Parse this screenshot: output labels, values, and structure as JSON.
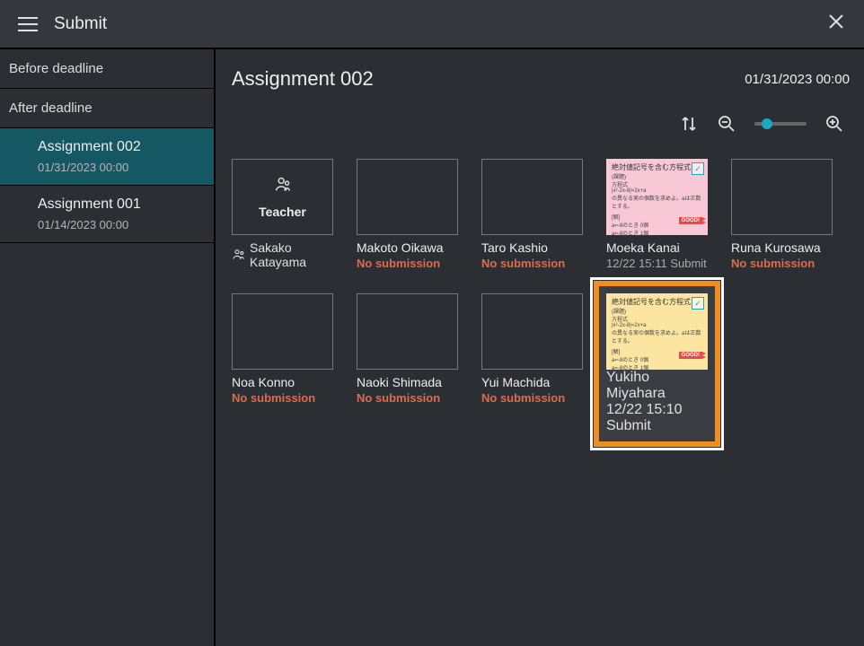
{
  "app": {
    "title": "Submit"
  },
  "sidebar": {
    "before_label": "Before deadline",
    "after_label": "After deadline",
    "assignments": [
      {
        "title": "Assignment 002",
        "date": "01/31/2023 00:00",
        "active": true
      },
      {
        "title": "Assignment 001",
        "date": "01/14/2023 00:00",
        "active": false
      }
    ]
  },
  "main": {
    "title": "Assignment 002",
    "deadline": "01/31/2023 00:00",
    "teacher_label": "Teacher",
    "teacher_name": "Sakako Katayama",
    "no_submission_label": "No submission",
    "doc_title": "絶対値記号を含む方程式",
    "good_label": "GOOD!"
  },
  "students": [
    {
      "name": "Makoto Oikawa",
      "submitted": false
    },
    {
      "name": "Taro Kashio",
      "submitted": false
    },
    {
      "name": "Moeka Kanai",
      "submitted": true,
      "status": "12/22 15:11 Submit",
      "theme": "pink"
    },
    {
      "name": "Runa Kurosawa",
      "submitted": false
    },
    {
      "name": "Noa Konno",
      "submitted": false
    },
    {
      "name": "Naoki Shimada",
      "submitted": false
    },
    {
      "name": "Yui Machida",
      "submitted": false
    },
    {
      "name": "Yukiho Miyahara",
      "submitted": true,
      "status": "12/22 15:10 Submit",
      "theme": "yellow",
      "highlighted": true
    }
  ]
}
